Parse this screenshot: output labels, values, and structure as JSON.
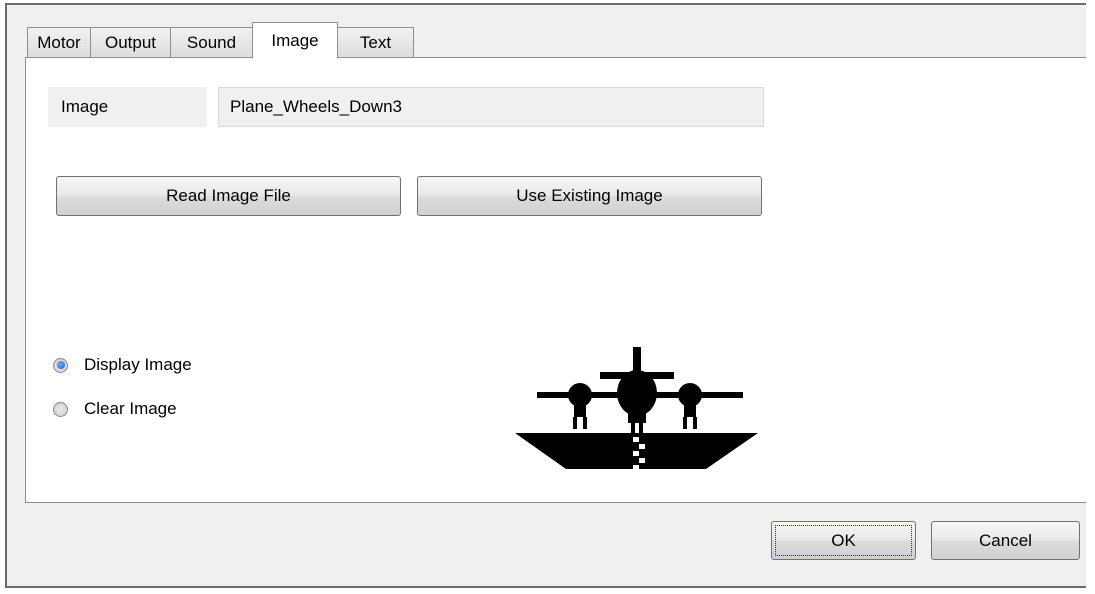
{
  "tabs": [
    {
      "label": "Motor",
      "active": false
    },
    {
      "label": "Output",
      "active": false
    },
    {
      "label": "Sound",
      "active": false
    },
    {
      "label": "Image",
      "active": true
    },
    {
      "label": "Text",
      "active": false
    }
  ],
  "image_field": {
    "label": "Image",
    "value": "Plane_Wheels_Down3"
  },
  "buttons": {
    "read": "Read Image File",
    "existing": "Use Existing Image",
    "ok": "OK",
    "cancel": "Cancel"
  },
  "radios": [
    {
      "label": "Display Image",
      "checked": true
    },
    {
      "label": "Clear Image",
      "checked": false
    }
  ],
  "preview": {
    "icon": "plane-wheels-down-icon"
  }
}
